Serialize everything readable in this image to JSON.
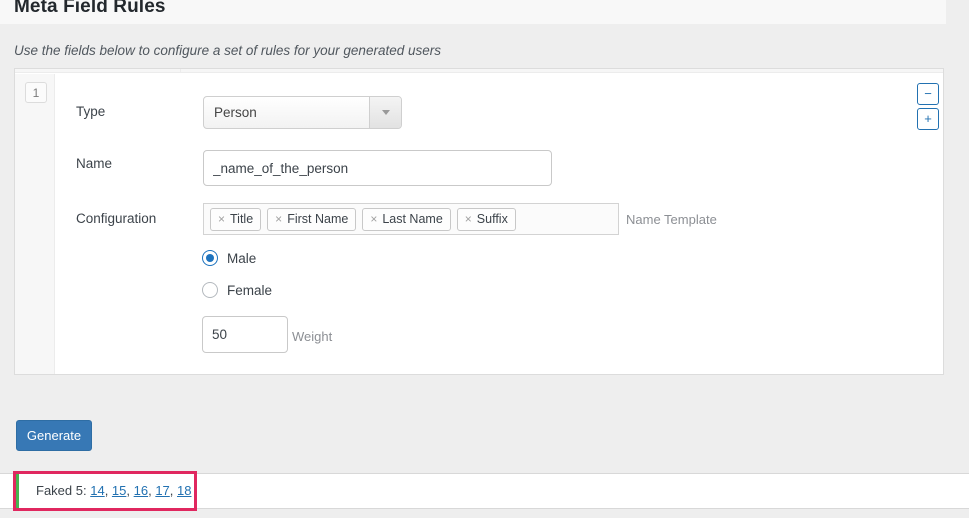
{
  "header": {
    "title": "Meta Field Rules"
  },
  "intro": {
    "text": "Use the fields below to configure a set of rules for your generated users"
  },
  "rule": {
    "number": "1",
    "type": {
      "label": "Type",
      "value": "Person",
      "options": [
        "Person"
      ]
    },
    "name": {
      "label": "Name",
      "value": "_name_of_the_person",
      "placeholder": ""
    },
    "configuration": {
      "label": "Configuration",
      "tokens": [
        {
          "remove": "×",
          "label": "Title"
        },
        {
          "remove": "×",
          "label": "First Name"
        },
        {
          "remove": "×",
          "label": "Last Name"
        },
        {
          "remove": "×",
          "label": "Suffix"
        }
      ],
      "side_label": "Name Template"
    },
    "gender": {
      "options": [
        {
          "label": "Male",
          "selected": true
        },
        {
          "label": "Female",
          "selected": false
        }
      ]
    },
    "weight": {
      "value": "50",
      "side_label": "Weight",
      "placeholder": ""
    },
    "controls": {
      "remove": "−",
      "add": "+"
    }
  },
  "actions": {
    "generate_label": "Generate"
  },
  "notice": {
    "prefix": "Faked 5:",
    "links": [
      "14",
      "15",
      "16",
      "17",
      "18"
    ],
    "separator": ", ",
    "accent_color": "#46b450",
    "highlight_color": "#e0275f"
  }
}
